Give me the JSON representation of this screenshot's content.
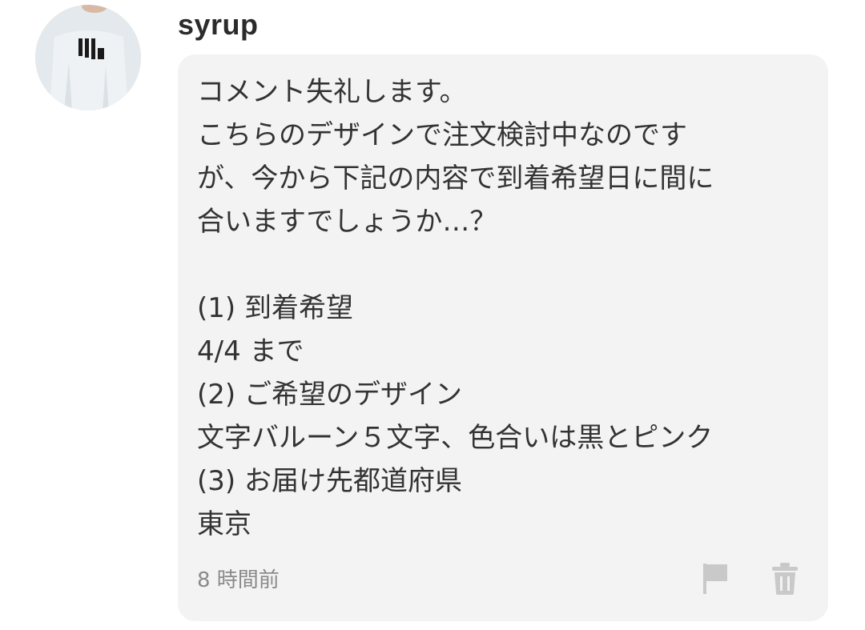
{
  "comment": {
    "username": "syrup",
    "lines": [
      "コメント失礼します。",
      "こちらのデザインで注文検討中なのです",
      "が、今から下記の内容で到着希望日に間に",
      "合いますでしょうか…？",
      "",
      "(1) 到着希望",
      "4/4 まで",
      "(2) ご希望のデザイン",
      "文字バルーン５文字、色合いは黒とピンク",
      "(3) お届け先都道府県",
      "東京"
    ],
    "timestamp": "8 時間前",
    "icons": {
      "avatar": "avatar-photo",
      "report": "flag-icon",
      "delete": "trash-icon"
    }
  },
  "colors": {
    "bubble_bg": "#f3f3f3",
    "text": "#333333",
    "timestamp": "#8a8a8a",
    "icon": "#c9c9c9"
  }
}
